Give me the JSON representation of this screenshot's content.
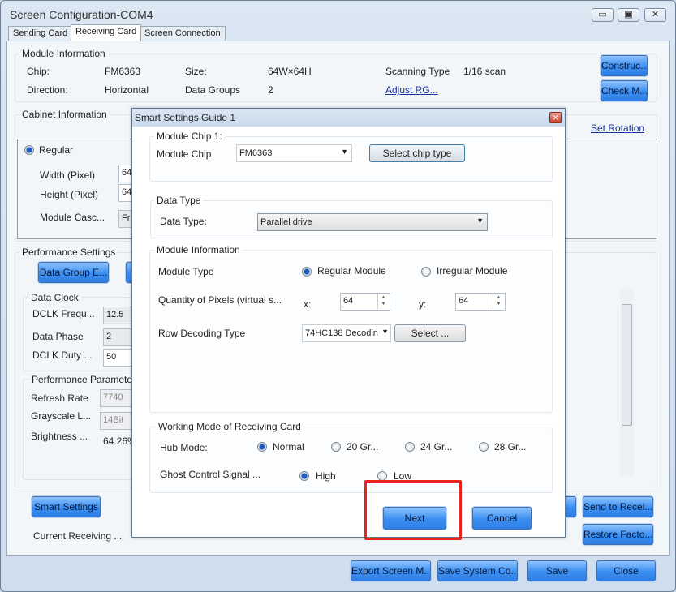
{
  "window": {
    "title": "Screen Configuration-COM4",
    "min": "▭",
    "max": "▣",
    "close": "✕"
  },
  "tabs": [
    {
      "label": "Sending Card"
    },
    {
      "label": "Receiving Card",
      "active": true
    },
    {
      "label": "Screen Connection"
    }
  ],
  "module_info": {
    "title": "Module Information",
    "chip_label": "Chip:",
    "chip": "FM6363",
    "size_label": "Size:",
    "size": "64W×64H",
    "scan_label": "Scanning Type",
    "scan": "1/16 scan",
    "direction_label": "Direction:",
    "direction": "Horizontal",
    "groups_label": "Data Groups",
    "groups": "2",
    "adjust_link": "Adjust RG...",
    "construct_btn": "Construc...",
    "check_btn": "Check M..."
  },
  "cabinet": {
    "title": "Cabinet Information",
    "set_rotation": "Set Rotation",
    "regular": "Regular",
    "width_label": "Width (Pixel)",
    "width": "64",
    "height_label": "Height (Pixel)",
    "height": "64",
    "cascade_label": "Module Casc...",
    "cascade": "Fr"
  },
  "performance": {
    "title": "Performance Settings",
    "data_group_btn": "Data Group E...",
    "data_clock": "Data Clock",
    "dclk_freq_label": "DCLK Frequ...",
    "dclk_freq": "12.5",
    "phase_label": "Data Phase",
    "phase": "2",
    "duty_label": "DCLK Duty ...",
    "duty": "50",
    "params_title": "Performance Paramete",
    "refresh_label": "Refresh Rate",
    "refresh": "7740",
    "gray_label": "Grayscale L...",
    "gray": "14Bit",
    "bright_label": "Brightness ...",
    "bright": "64.26%"
  },
  "bottom": {
    "smart_settings": "Smart Settings",
    "current_receiving": "Current Receiving ...",
    "send_btn": "Send to Recei...",
    "restore_btn": "Restore Facto...",
    "export_btn": "Export Screen M...",
    "save_sys_btn": "Save System Co...",
    "save_btn": "Save",
    "close_btn": "Close"
  },
  "dialog": {
    "title": "Smart Settings Guide 1",
    "chip_group": "Module Chip 1:",
    "chip_label": "Module Chip",
    "chip_value": "FM6363",
    "select_chip_btn": "Select chip type",
    "datatype_group": "Data Type",
    "datatype_label": "Data Type:",
    "datatype_value": "Parallel drive",
    "modinfo_group": "Module Information",
    "modtype_label": "Module Type",
    "regular_module": "Regular Module",
    "irregular_module": "Irregular Module",
    "pixels_label": "Quantity of Pixels (virtual s...",
    "x_label": "x:",
    "x_value": "64",
    "y_label": "y:",
    "y_value": "64",
    "rowdec_label": "Row Decoding Type",
    "rowdec_value": "74HC138 Decodin",
    "select_btn": "Select ...",
    "working_group": "Working Mode of Receiving Card",
    "hub_label": "Hub Mode:",
    "hub_options": [
      "Normal",
      "20 Gr...",
      "24 Gr...",
      "28 Gr..."
    ],
    "ghost_label": "Ghost Control Signal ...",
    "ghost_high": "High",
    "ghost_low": "Low",
    "next_btn": "Next",
    "cancel_btn": "Cancel"
  },
  "highlight_color": "#e8241c"
}
